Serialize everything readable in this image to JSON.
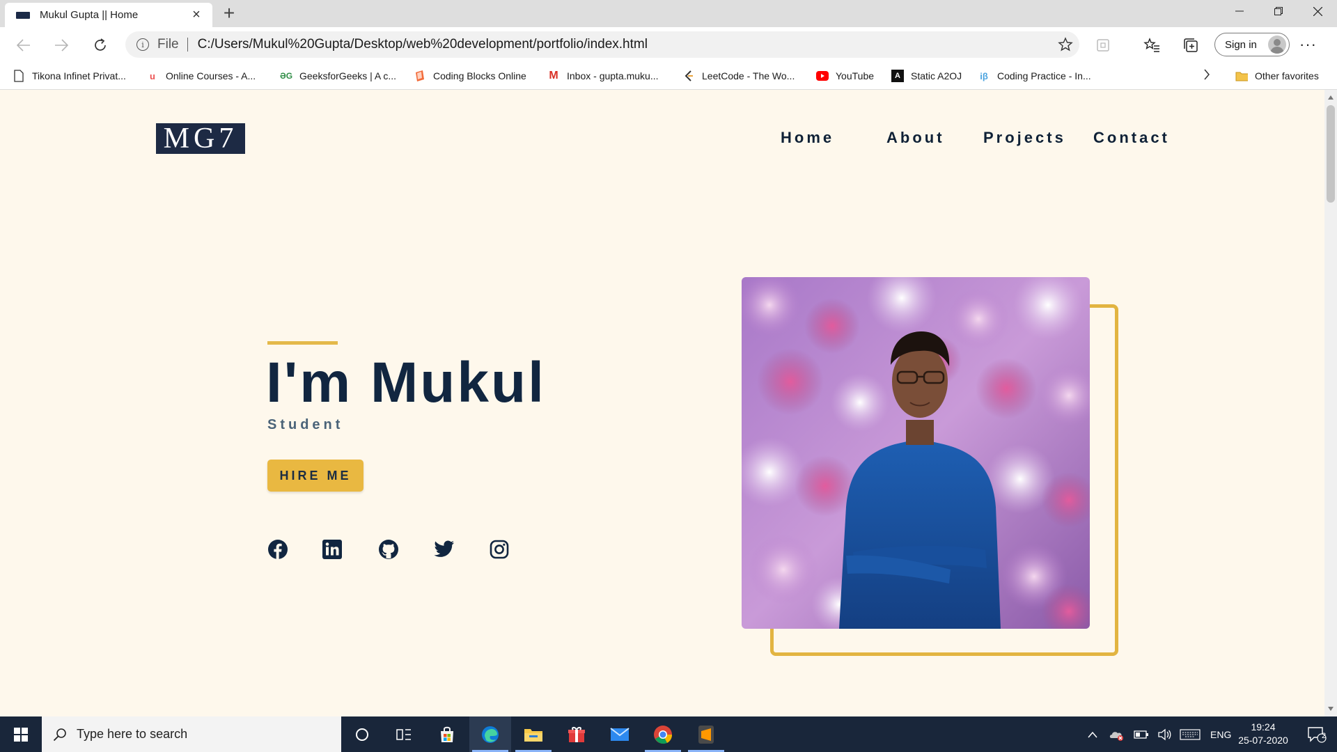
{
  "browser": {
    "tab_title": "Mukul Gupta || Home",
    "url_scheme": "File",
    "url": "C:/Users/Mukul%20Gupta/Desktop/web%20development/portfolio/index.html",
    "signin_label": "Sign in"
  },
  "favorites": [
    {
      "label": "Tikona Infinet Privat...",
      "icon": "page-icon"
    },
    {
      "label": "Online Courses - A...",
      "icon": "udemy-icon"
    },
    {
      "label": "GeeksforGeeks | A c...",
      "icon": "gfg-icon"
    },
    {
      "label": "Coding Blocks Online",
      "icon": "coding-blocks-icon"
    },
    {
      "label": "Inbox - gupta.muku...",
      "icon": "gmail-icon"
    },
    {
      "label": "LeetCode - The Wo...",
      "icon": "leetcode-icon"
    },
    {
      "label": "YouTube",
      "icon": "youtube-icon"
    },
    {
      "label": "Static A2OJ",
      "icon": "a2oj-icon"
    },
    {
      "label": "Coding Practice - In...",
      "icon": "interviewbit-icon"
    }
  ],
  "other_favorites": "Other favorites",
  "site": {
    "logo": "MG7",
    "nav": [
      "Home",
      "About",
      "Projects",
      "Contact"
    ],
    "hero_title": "I'm Mukul",
    "hero_subtitle": "Student",
    "cta": "HIRE ME",
    "socials": [
      "facebook-icon",
      "linkedin-icon",
      "github-icon",
      "twitter-icon",
      "instagram-icon"
    ],
    "accent_color": "#e9b841",
    "text_color": "#112640",
    "background_color": "#fef8ec"
  },
  "taskbar": {
    "search_placeholder": "Type here to search",
    "language": "ENG",
    "time": "19:24",
    "date": "25-07-2020",
    "notification_count": "2"
  }
}
